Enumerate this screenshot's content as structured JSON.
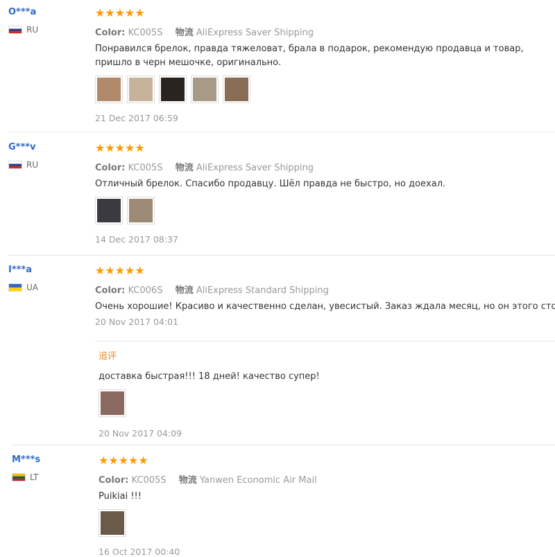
{
  "reviews": [
    {
      "user": "O***a",
      "country": "RU",
      "flag": "ru",
      "stars": "★★★★★",
      "color_label": "Color:",
      "color_value": "KC005S",
      "logistics_label": "物流",
      "logistics_value": "AliExpress Saver Shipping",
      "text": "Понравился брелок, правда тяжеловат, брала в подарок, рекомендую продавца и товар, пришло в черн мешочке, оригинально.",
      "photos": [
        "#b08a6a",
        "#c6b39a",
        "#2a2420",
        "#a89a86",
        "#8a6d55"
      ],
      "date": "21 Dec 2017 06:59"
    },
    {
      "user": "G***v",
      "country": "RU",
      "flag": "ru",
      "stars": "★★★★★",
      "color_label": "Color:",
      "color_value": "KC005S",
      "logistics_label": "物流",
      "logistics_value": "AliExpress Saver Shipping",
      "text": "Отличный брелок. Спасибо продавцу. Шёл правда не быстро, но доехал.",
      "photos": [
        "#3a3a40",
        "#9c8a74"
      ],
      "date": "14 Dec 2017 08:37"
    },
    {
      "user": "I***a",
      "country": "UA",
      "flag": "ua",
      "stars": "★★★★★",
      "color_label": "Color:",
      "color_value": "KC006S",
      "logistics_label": "物流",
      "logistics_value": "AliExpress Standard Shipping",
      "text": "Очень хорошие! Красиво и качественно сделан, увесистый. Заказ ждала месяц, но он этого стоит.",
      "date": "20 Nov 2017 04:01",
      "followup": {
        "title": "追评",
        "text": "доставка быстрая!!! 18 дней! качество супер!",
        "photos": [
          "#8a6a60"
        ],
        "date": "20 Nov 2017 04:09"
      }
    },
    {
      "user": "M***s",
      "country": "LT",
      "flag": "lt",
      "stars": "★★★★★",
      "color_label": "Color:",
      "color_value": "KC005S",
      "logistics_label": "物流",
      "logistics_value": "Yanwen Economic Air Mail",
      "text": "Puikiai !!!",
      "photos": [
        "#6a5a4a"
      ],
      "date": "16 Oct 2017 00:40"
    }
  ]
}
